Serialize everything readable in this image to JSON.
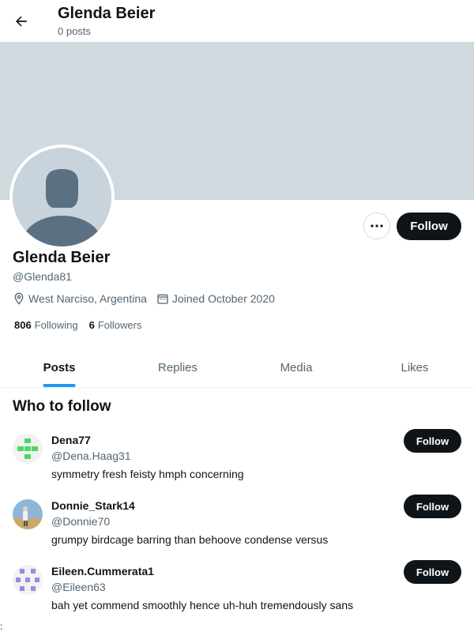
{
  "header": {
    "title": "Glenda Beier",
    "subtitle": "0 posts",
    "back_icon": "arrow-left-icon"
  },
  "profile": {
    "display_name": "Glenda Beier",
    "handle": "@Glenda81",
    "location": "West Narciso, Argentina",
    "joined": "Joined October 2020",
    "following_count": "806",
    "following_label": "Following",
    "followers_count": "6",
    "followers_label": "Followers",
    "follow_label": "Follow",
    "banner_color": "#cfd9de"
  },
  "tabs": [
    {
      "label": "Posts",
      "active": true
    },
    {
      "label": "Replies",
      "active": false
    },
    {
      "label": "Media",
      "active": false
    },
    {
      "label": "Likes",
      "active": false
    }
  ],
  "who_to_follow": {
    "title": "Who to follow",
    "items": [
      {
        "name": "Dena77",
        "handle": "@Dena.Haag31",
        "bio": "symmetry fresh feisty hmph concerning",
        "follow_label": "Follow"
      },
      {
        "name": "Donnie_Stark14",
        "handle": "@Donnie70",
        "bio": "grumpy birdcage barring than behoove condense versus",
        "follow_label": "Follow"
      },
      {
        "name": "Eileen.Cummerata1",
        "handle": "@Eileen63",
        "bio": "bah yet commend smoothly hence uh-huh tremendously sans",
        "follow_label": "Follow"
      }
    ]
  },
  "footer_mark": ":",
  "colors": {
    "accent": "#1d9bf0",
    "button_dark": "#0f1419",
    "muted": "#536471"
  }
}
